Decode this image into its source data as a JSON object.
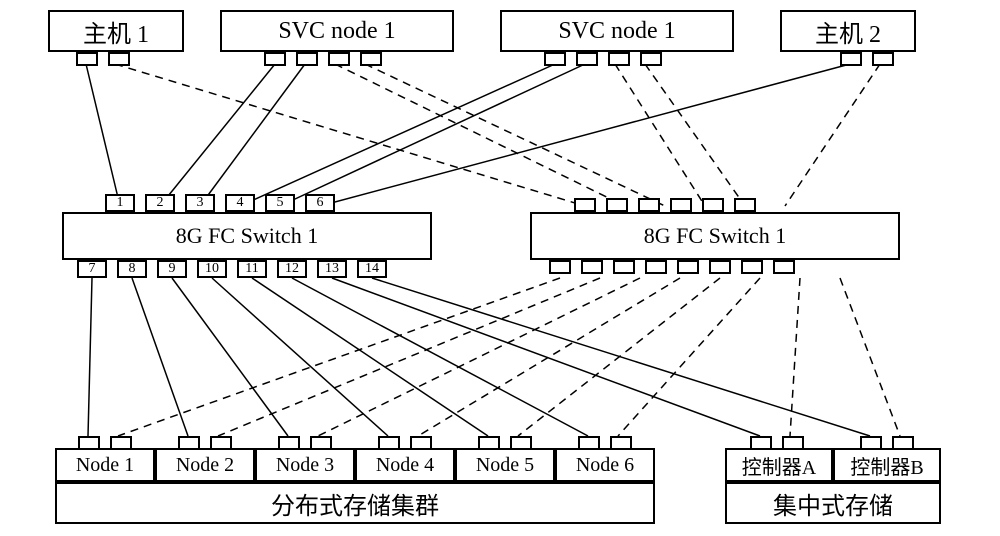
{
  "top": {
    "host1": "主机 1",
    "svc1": "SVC node 1",
    "svc2": "SVC node 1",
    "host2": "主机 2"
  },
  "switches": {
    "left": "8G FC Switch 1",
    "right": "8G FC Switch 1",
    "top_ports": [
      "1",
      "2",
      "3",
      "4",
      "5",
      "6"
    ],
    "bottom_ports": [
      "7",
      "8",
      "9",
      "10",
      "11",
      "12",
      "13",
      "14"
    ]
  },
  "bottom": {
    "nodes": [
      "Node 1",
      "Node 2",
      "Node 3",
      "Node 4",
      "Node 5",
      "Node 6"
    ],
    "cluster_label": "分布式存储集群",
    "ctrlA": "控制器A",
    "ctrlB": "控制器B",
    "central_label": "集中式存储"
  }
}
